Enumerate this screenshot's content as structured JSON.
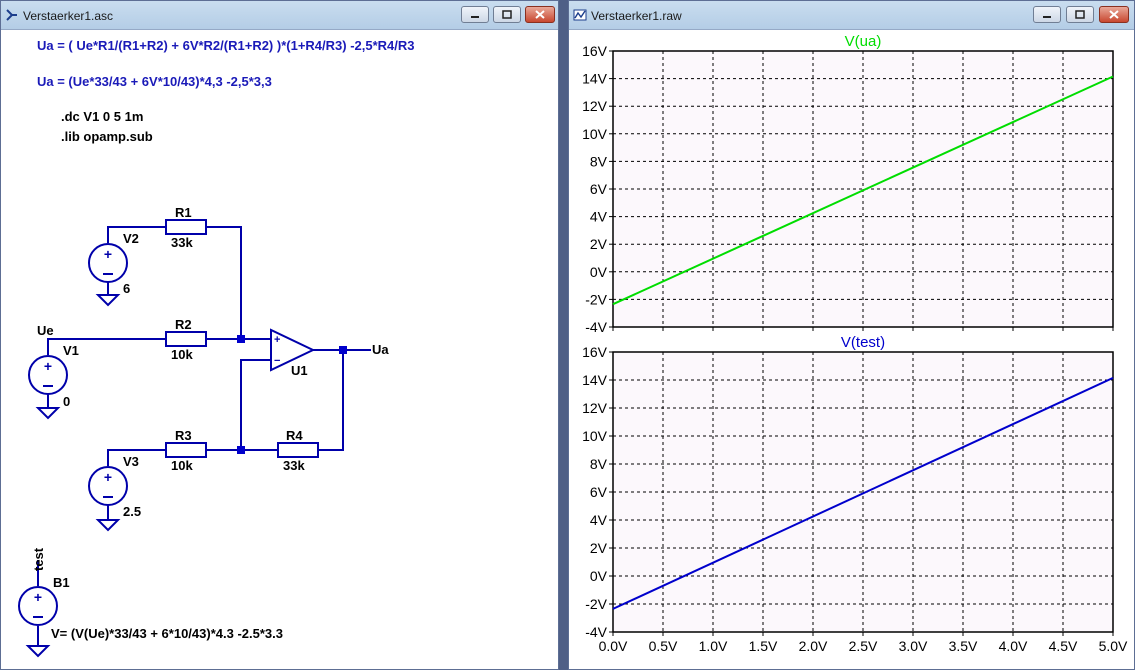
{
  "left_window": {
    "title": "Verstaerker1.asc",
    "equations": {
      "line1": "Ua =  ( Ue*R1/(R1+R2) + 6V*R2/(R1+R2) )*(1+R4/R3) -2,5*R4/R3",
      "line2": "Ua = (Ue*33/43 + 6V*10/43)*4,3 -2,5*3,3"
    },
    "directives": {
      "dc": ".dc V1 0 5 1m",
      "lib": ".lib opamp.sub"
    },
    "schematic": {
      "R1": {
        "name": "R1",
        "value": "33k"
      },
      "R2": {
        "name": "R2",
        "value": "10k"
      },
      "R3": {
        "name": "R3",
        "value": "10k"
      },
      "R4": {
        "name": "R4",
        "value": "33k"
      },
      "V1": {
        "name": "V1",
        "value": "0"
      },
      "V2": {
        "name": "V2",
        "value": "6"
      },
      "V3": {
        "name": "V3",
        "value": "2.5"
      },
      "U1": "U1",
      "B1": {
        "name": "B1",
        "expr": "V= (V(Ue)*33/43 + 6*10/43)*4.3 -2.5*3.3"
      },
      "nets": {
        "ue": "Ue",
        "ua": "Ua",
        "test": "test"
      },
      "opamp_plus": "+",
      "opamp_minus": "−"
    }
  },
  "right_window": {
    "title": "Verstaerker1.raw"
  },
  "colors": {
    "wire": "#0000aa",
    "text_blue": "#1a1ab8",
    "trace_ua": "#00dd00",
    "trace_test": "#0000cc",
    "plot_bg": "#fcf8fc",
    "grid": "#000000"
  },
  "chart_data": [
    {
      "type": "line",
      "title": "V(ua)",
      "x_tick_labels": [
        "0.0V",
        "0.5V",
        "1.0V",
        "1.5V",
        "2.0V",
        "2.5V",
        "3.0V",
        "3.5V",
        "4.0V",
        "4.5V",
        "5.0V"
      ],
      "y_tick_labels": [
        "16V",
        "14V",
        "12V",
        "10V",
        "8V",
        "6V",
        "4V",
        "2V",
        "0V",
        "-2V",
        "-4V"
      ],
      "xlim": [
        0,
        5
      ],
      "ylim": [
        -4,
        16
      ],
      "grid": true,
      "series": [
        {
          "name": "V(ua)",
          "x": [
            0,
            5
          ],
          "y": [
            -2.35,
            14.15
          ]
        }
      ]
    },
    {
      "type": "line",
      "title": "V(test)",
      "x_tick_labels": [
        "0.0V",
        "0.5V",
        "1.0V",
        "1.5V",
        "2.0V",
        "2.5V",
        "3.0V",
        "3.5V",
        "4.0V",
        "4.5V",
        "5.0V"
      ],
      "y_tick_labels": [
        "16V",
        "14V",
        "12V",
        "10V",
        "8V",
        "6V",
        "4V",
        "2V",
        "0V",
        "-2V",
        "-4V"
      ],
      "xlim": [
        0,
        5
      ],
      "ylim": [
        -4,
        16
      ],
      "grid": true,
      "series": [
        {
          "name": "V(test)",
          "x": [
            0,
            5
          ],
          "y": [
            -2.35,
            14.15
          ]
        }
      ]
    }
  ]
}
